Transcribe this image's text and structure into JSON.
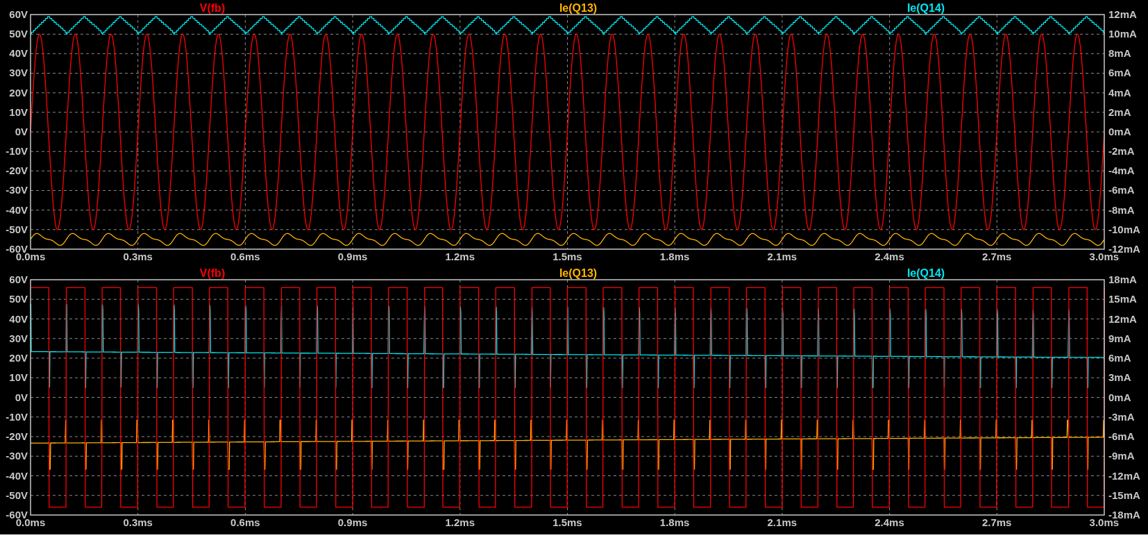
{
  "panes": [
    {
      "traces": [
        {
          "name": "V(fb)",
          "color": "#ff0000"
        },
        {
          "name": "Ie(Q13)",
          "color": "#ffb400"
        },
        {
          "name": "Ie(Q14)",
          "color": "#00e5f0"
        }
      ],
      "left_ticks": [
        "60V",
        "50V",
        "40V",
        "30V",
        "20V",
        "10V",
        "0V",
        "-10V",
        "-20V",
        "-30V",
        "-40V",
        "-50V",
        "-60V"
      ],
      "right_ticks": [
        "12mA",
        "10mA",
        "8mA",
        "6mA",
        "4mA",
        "2mA",
        "0mA",
        "-2mA",
        "-4mA",
        "-6mA",
        "-8mA",
        "-10mA",
        "-12mA"
      ],
      "x_ticks": [
        "0.0ms",
        "0.3ms",
        "0.6ms",
        "0.9ms",
        "1.2ms",
        "1.5ms",
        "1.8ms",
        "2.1ms",
        "2.4ms",
        "2.7ms",
        "3.0ms"
      ]
    },
    {
      "traces": [
        {
          "name": "V(fb)",
          "color": "#ff0000"
        },
        {
          "name": "Ie(Q13)",
          "color": "#ffb400"
        },
        {
          "name": "Ie(Q14)",
          "color": "#00e5f0"
        }
      ],
      "left_ticks": [
        "60V",
        "50V",
        "40V",
        "30V",
        "20V",
        "10V",
        "0V",
        "-10V",
        "-20V",
        "-30V",
        "-40V",
        "-50V",
        "-60V"
      ],
      "right_ticks": [
        "18mA",
        "15mA",
        "12mA",
        "9mA",
        "6mA",
        "3mA",
        "0mA",
        "-3mA",
        "-6mA",
        "-9mA",
        "-12mA",
        "-15mA",
        "-18mA"
      ],
      "x_ticks": [
        "0.0ms",
        "0.3ms",
        "0.6ms",
        "0.9ms",
        "1.2ms",
        "1.5ms",
        "1.8ms",
        "2.1ms",
        "2.4ms",
        "2.7ms",
        "3.0ms"
      ]
    }
  ]
}
